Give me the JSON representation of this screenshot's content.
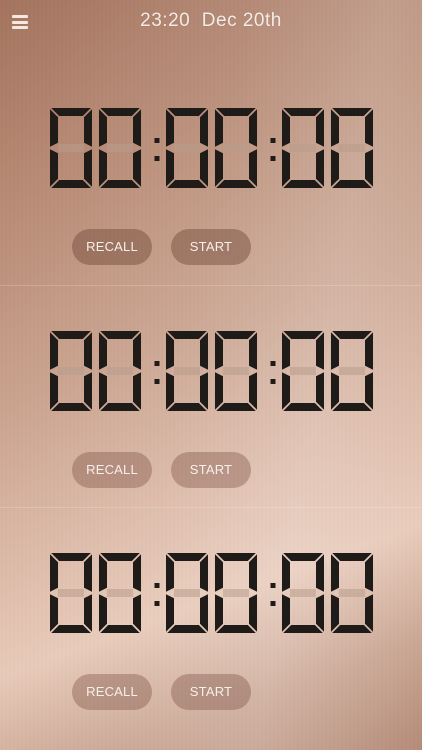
{
  "header": {
    "time": "23:20",
    "date": "Dec 20th",
    "menu_icon": "hamburger-menu-icon"
  },
  "timers": [
    {
      "display": "00:00:00",
      "recall_label": "RECALL",
      "start_label": "START"
    },
    {
      "display": "00:00:00",
      "recall_label": "RECALL",
      "start_label": "START"
    },
    {
      "display": "00:00:00",
      "recall_label": "RECALL",
      "start_label": "START"
    }
  ],
  "colors": {
    "digit_on": "#1f1b19",
    "digit_off": "#b89c8c",
    "button_text": "#f7efea",
    "header_text": "#f4ece7"
  }
}
